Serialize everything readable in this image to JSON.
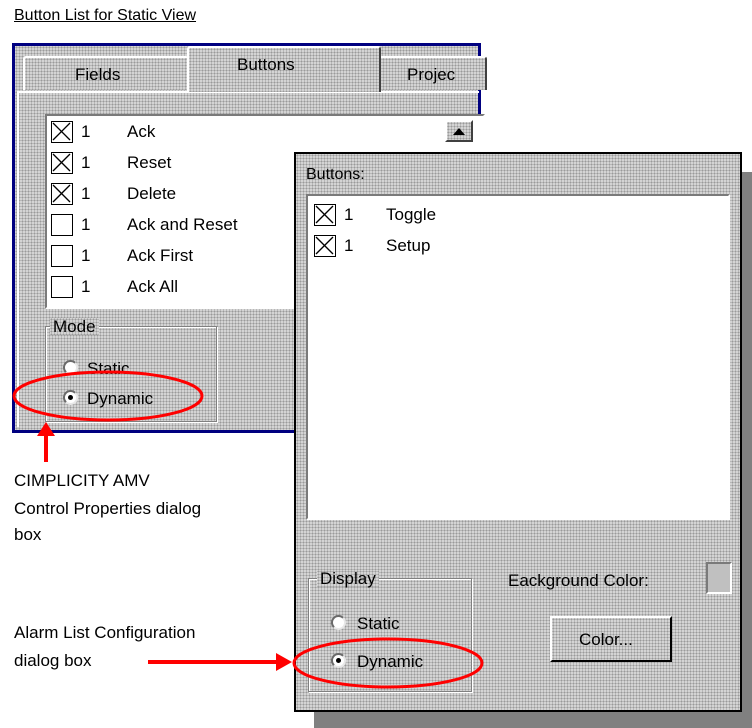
{
  "caption_title": "Button List for Static View",
  "amv_dialog": {
    "tabs": [
      {
        "label": "Fields"
      },
      {
        "label": "Buttons"
      },
      {
        "label": "Projec"
      }
    ],
    "button_list": [
      {
        "checked": true,
        "count": "1",
        "label": "Ack"
      },
      {
        "checked": true,
        "count": "1",
        "label": "Reset"
      },
      {
        "checked": true,
        "count": "1",
        "label": "Delete"
      },
      {
        "checked": false,
        "count": "1",
        "label": "Ack and Reset"
      },
      {
        "checked": false,
        "count": "1",
        "label": "Ack First"
      },
      {
        "checked": false,
        "count": "1",
        "label": "Ack All"
      }
    ],
    "mode_group_label": "Mode",
    "mode_options": [
      {
        "label": "Static",
        "selected": false
      },
      {
        "label": "Dynamic",
        "selected": true
      }
    ]
  },
  "callout_amv_lines": [
    "CIMPLICITY AMV",
    "Control Properties dialog",
    "box"
  ],
  "callout_alarm_lines": [
    "Alarm List Configuration",
    "dialog box"
  ],
  "alarm_dialog": {
    "buttons_label": "Buttons:",
    "button_list": [
      {
        "checked": true,
        "count": "1",
        "label": "Toggle"
      },
      {
        "checked": true,
        "count": "1",
        "label": "Setup"
      }
    ],
    "display_group_label": "Display",
    "display_options": [
      {
        "label": "Static",
        "selected": false
      },
      {
        "label": "Dynamic",
        "selected": true
      }
    ],
    "background_color_label": "Eackground Color:",
    "color_button_label": "Color..."
  },
  "colors": {
    "annotation_red": "#ff0000",
    "dialog_border_blue": "#000080",
    "dialog_face": "#d4d4d4"
  },
  "icons": {
    "checked_box": "checkbox-x-icon",
    "scroll_up": "scroll-up-arrow-icon",
    "arrow": "red-arrow-icon"
  }
}
